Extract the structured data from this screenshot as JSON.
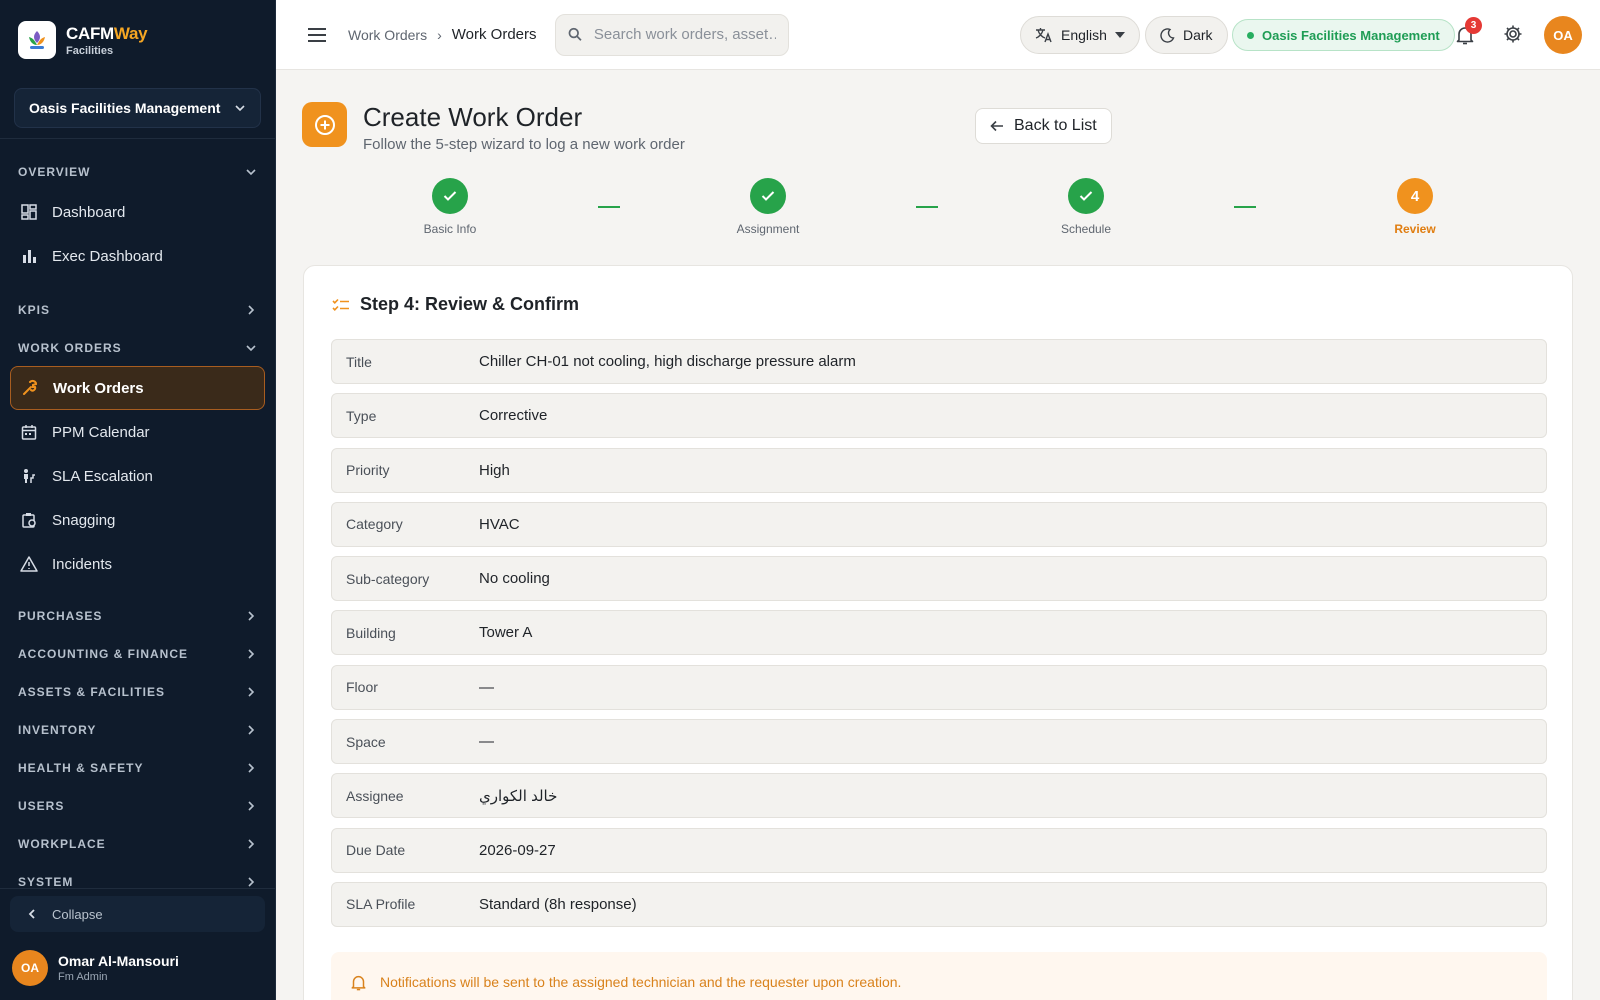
{
  "brand": {
    "name_a": "CAFM",
    "name_b": "Way",
    "subtitle": "Facilities"
  },
  "sidebar": {
    "org": "Oasis Facilities Management",
    "overview": {
      "label": "OVERVIEW",
      "items": [
        {
          "label": "Dashboard",
          "icon": "dashboard-icon"
        },
        {
          "label": "Exec Dashboard",
          "icon": "bar-chart-icon"
        }
      ]
    },
    "kpis": {
      "label": "KPIS"
    },
    "work_orders": {
      "label": "WORK ORDERS",
      "items": [
        {
          "label": "Work Orders",
          "icon": "wrench-icon",
          "active": true
        },
        {
          "label": "PPM Calendar",
          "icon": "calendar-icon"
        },
        {
          "label": "SLA Escalation",
          "icon": "escalation-icon"
        },
        {
          "label": "Snagging",
          "icon": "clipboard-icon"
        },
        {
          "label": "Incidents",
          "icon": "warning-icon"
        }
      ]
    },
    "sections": [
      "PURCHASES",
      "ACCOUNTING & FINANCE",
      "ASSETS & FACILITIES",
      "INVENTORY",
      "HEALTH & SAFETY",
      "USERS",
      "WORKPLACE",
      "SYSTEM"
    ],
    "collapse_label": "Collapse",
    "user": {
      "initials": "OA",
      "name": "Omar Al-Mansouri",
      "role": "Fm Admin"
    }
  },
  "topbar": {
    "breadcrumb": [
      "Work Orders",
      "Work Orders"
    ],
    "search_placeholder": "Search work orders, asset…",
    "language": "English",
    "theme": "Dark",
    "org_badge": "Oasis Facilities Management",
    "notifications_count": "3",
    "avatar_initials": "OA"
  },
  "page": {
    "title": "Create Work Order",
    "subtitle": "Follow the 5-step wizard to log a new work order",
    "back_label": "Back to List",
    "steps": [
      {
        "label": "Basic Info",
        "status": "done"
      },
      {
        "label": "Assignment",
        "status": "done"
      },
      {
        "label": "Schedule",
        "status": "done"
      },
      {
        "label": "Review",
        "status": "current",
        "number": "4"
      }
    ],
    "card_title": "Step 4: Review & Confirm",
    "review_rows": [
      {
        "label": "Title",
        "value": "Chiller CH-01 not cooling, high discharge pressure alarm"
      },
      {
        "label": "Type",
        "value": "Corrective"
      },
      {
        "label": "Priority",
        "value": "High"
      },
      {
        "label": "Category",
        "value": "HVAC"
      },
      {
        "label": "Sub-category",
        "value": "No cooling"
      },
      {
        "label": "Building",
        "value": "Tower A"
      },
      {
        "label": "Floor",
        "value": "—"
      },
      {
        "label": "Space",
        "value": "—"
      },
      {
        "label": "Assignee",
        "value": "خالد الكواري"
      },
      {
        "label": "Due Date",
        "value": "2026-09-27"
      },
      {
        "label": "SLA Profile",
        "value": "Standard (8h response)"
      }
    ],
    "notice": "Notifications will be sent to the assigned technician and the requester upon creation."
  },
  "colors": {
    "accent": "#f0921e",
    "success": "#27a34a",
    "sidebar_bg": "#0f1b2b"
  }
}
